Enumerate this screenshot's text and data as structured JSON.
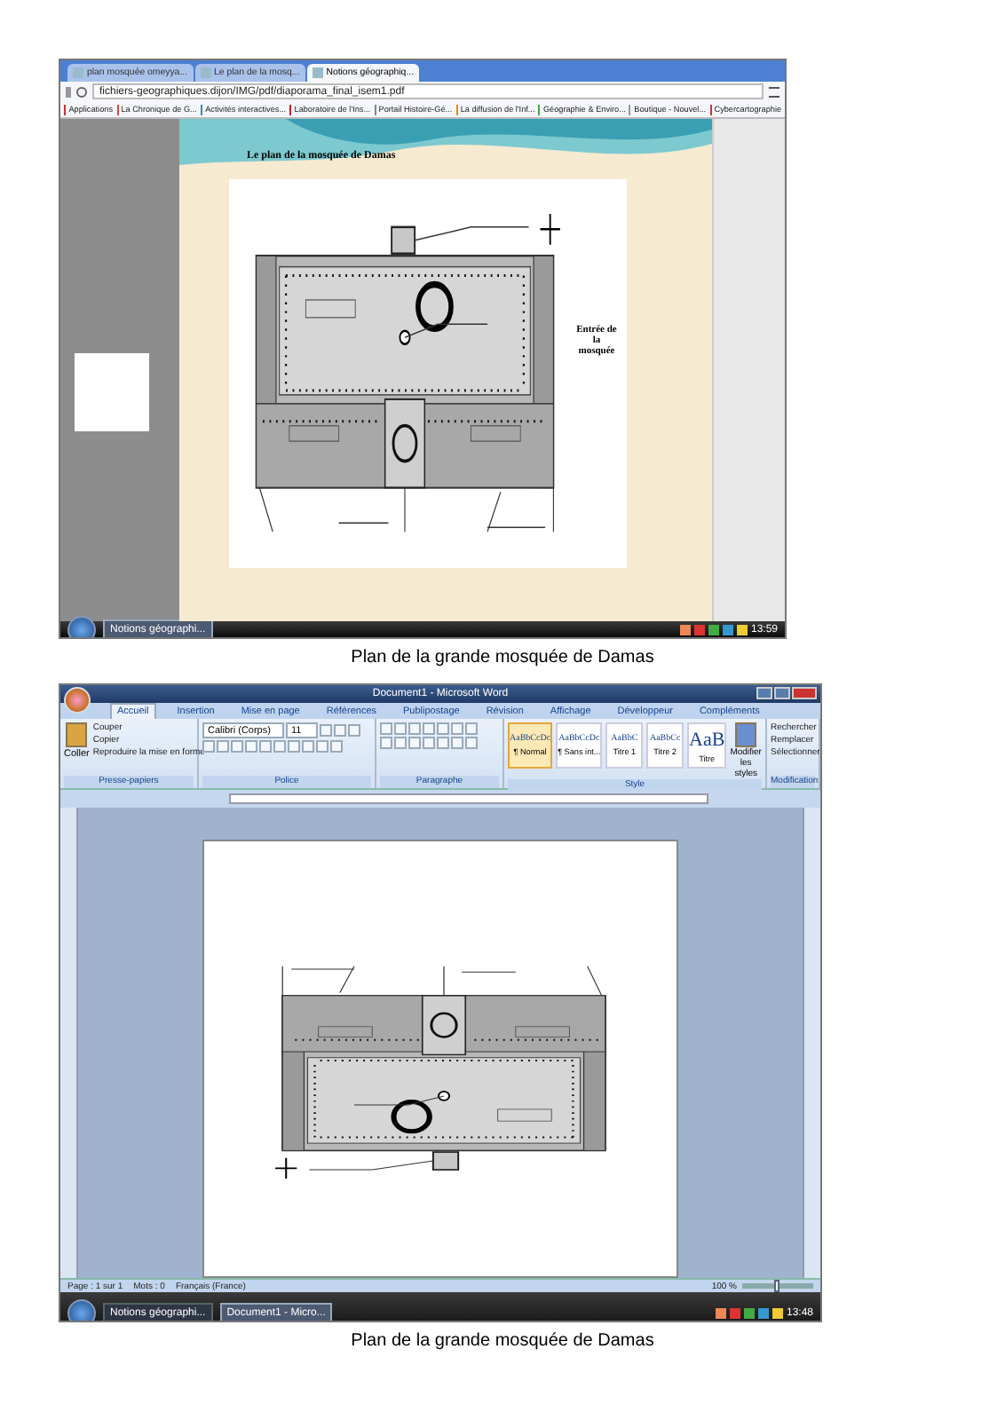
{
  "figures": [
    {
      "kind": "browser",
      "tabs": [
        {
          "label": "plan mosquée omeyya...",
          "selected": false
        },
        {
          "label": "Le plan de la mosq...",
          "selected": false
        },
        {
          "label": "Notions géographiq...",
          "selected": true
        }
      ],
      "address": "fichiers-geographiques.dijon/IMG/pdf/diaporama_final_isem1.pdf",
      "bookmarks": [
        "Applications",
        "La Chronique de G...",
        "Activités interactives...",
        "Laboratoire de l'Ins...",
        "Portail Histoire-Gé...",
        "La diffusion de l'Inf...",
        "Géographie & Enviro...",
        "Boutique - Nouvel...",
        "Cybercartographie"
      ],
      "document": {
        "heading": "Le plan de la mosquée de Damas",
        "entrance_label": "Entrée de la mosquée"
      },
      "taskbar": {
        "items": [
          {
            "label": "Notions géographi...",
            "selected": true
          }
        ],
        "clock": "13:59"
      },
      "caption": "Plan de la grande mosquée de Damas"
    },
    {
      "kind": "word",
      "title": "Document1 - Microsoft Word",
      "ribbon_tabs": [
        {
          "label": "Accueil",
          "selected": true
        },
        {
          "label": "Insertion",
          "selected": false
        },
        {
          "label": "Mise en page",
          "selected": false
        },
        {
          "label": "Références",
          "selected": false
        },
        {
          "label": "Publipostage",
          "selected": false
        },
        {
          "label": "Révision",
          "selected": false
        },
        {
          "label": "Affichage",
          "selected": false
        },
        {
          "label": "Développeur",
          "selected": false
        },
        {
          "label": "Compléments",
          "selected": false
        }
      ],
      "clipboard": {
        "paste": "Coller",
        "actions": [
          "Couper",
          "Copier",
          "Reproduire la mise en forme"
        ],
        "label": "Presse-papiers"
      },
      "font": {
        "family": "Calibri (Corps)",
        "size": "11",
        "label": "Police"
      },
      "paragraph_label": "Paragraphe",
      "styles": [
        {
          "preview": "AaBbCcDc",
          "name": "¶ Normal",
          "selected": true
        },
        {
          "preview": "AaBbCcDc",
          "name": "¶ Sans int...",
          "selected": false
        },
        {
          "preview": "AaBbC",
          "name": "Titre 1",
          "selected": false
        },
        {
          "preview": "AaBbCc",
          "name": "Titre 2",
          "selected": false
        },
        {
          "preview": "AaB",
          "name": "Titre",
          "selected": false
        }
      ],
      "change_styles": "Modifier les styles",
      "styles_label": "Style",
      "editing": [
        "Rechercher",
        "Remplacer",
        "Sélectionner"
      ],
      "editing_label": "Modification",
      "status": [
        "Page : 1 sur 1",
        "Mots : 0",
        "Français (France)"
      ],
      "zoom": "100 %",
      "zoom_slider": {
        "level": 0.5
      },
      "taskbar": {
        "items": [
          {
            "label": "Notions géographi...",
            "selected": false
          },
          {
            "label": "Document1 - Micro...",
            "selected": true
          }
        ],
        "clock": "13:48"
      },
      "caption": "Plan de la grande mosquée de Damas"
    }
  ]
}
